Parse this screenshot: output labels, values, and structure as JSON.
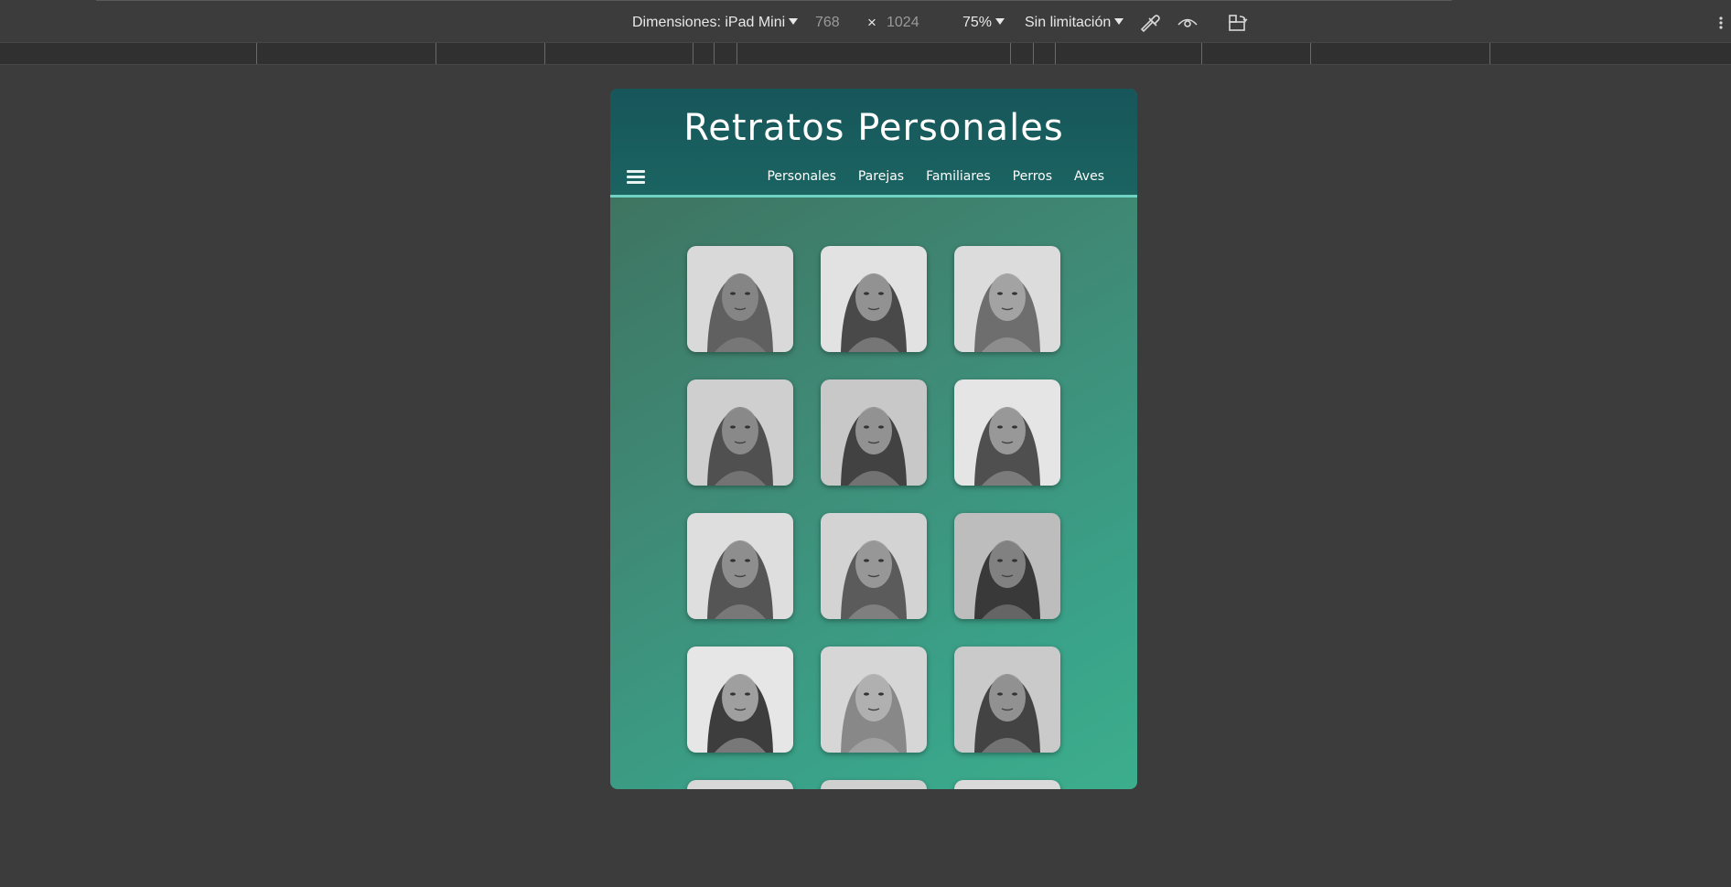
{
  "devtools": {
    "dimensions_label": "Dimensiones: iPad Mini",
    "width_value": "768",
    "times": "×",
    "height_value": "1024",
    "zoom": "75%",
    "throttling": "Sin limitación",
    "icons": [
      "eyedropper-icon",
      "eye-icon",
      "rotate-device-icon",
      "more-options-icon"
    ]
  },
  "site": {
    "title": "Retratos Personales",
    "menu_icon": "hamburger-menu-icon",
    "nav": [
      "Personales",
      "Parejas",
      "Familiares",
      "Perros",
      "Aves"
    ],
    "colors": {
      "header": "#17565a",
      "accent_line": "#6fd3c4",
      "background_start": "#3d6e5b",
      "background_end": "#3cae8c"
    }
  },
  "gallery": {
    "columns": 3,
    "rows_visible": 5,
    "thumbnail_style": "pencil portrait drawing"
  }
}
